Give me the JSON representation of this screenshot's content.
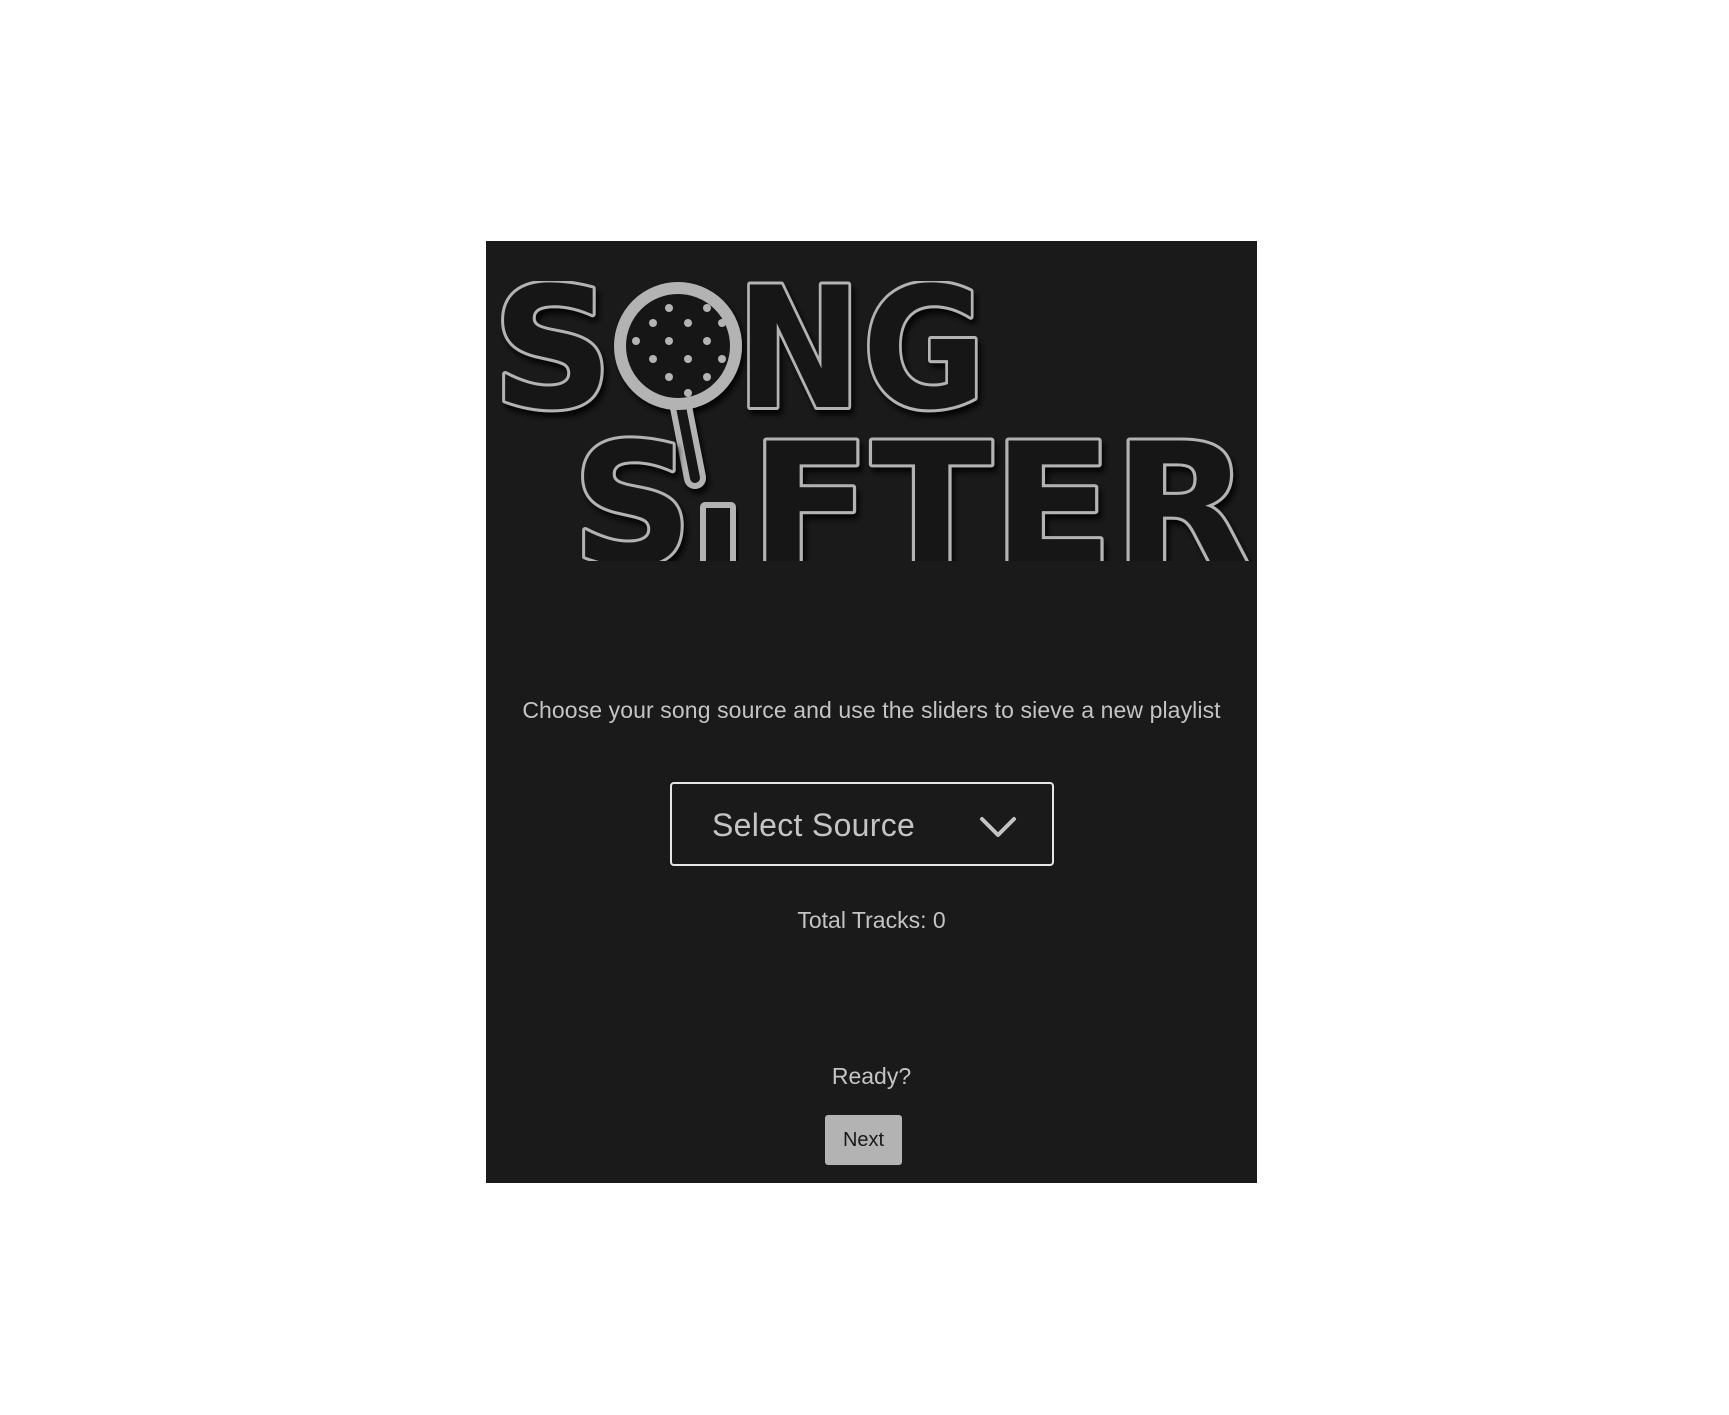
{
  "logo": {
    "word1": "SONG",
    "word2": "SIFTER",
    "line1_left": "S",
    "line1_right": "NG",
    "line2_left": "S",
    "line2_right": "FTER",
    "icon": "sieve-icon",
    "stroke_color": "#b3b3b3"
  },
  "tagline": "Choose your song source and use the sliders to sieve a new playlist",
  "source_select": {
    "selected": "Select Source",
    "icon": "chevron-down-icon"
  },
  "total_tracks": "Total Tracks: 0",
  "ready": "Ready?",
  "next_button": "Next",
  "colors": {
    "panel_bg": "#1a1a1a",
    "page_bg": "#ffffff",
    "text": "#c4c4c4",
    "button_bg": "#b3b3b3",
    "select_border": "#e6e6e6"
  }
}
